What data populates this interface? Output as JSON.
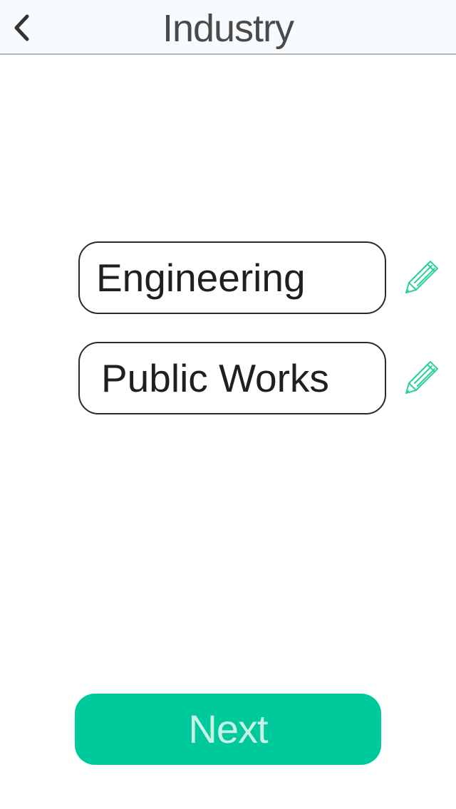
{
  "header": {
    "title": "Industry",
    "back_icon": "chevron-left-icon"
  },
  "fields": [
    {
      "value": "Engineering",
      "edit_icon": "pencil-icon"
    },
    {
      "value": "Public Works",
      "edit_icon": "pencil-icon"
    }
  ],
  "footer": {
    "next_label": "Next"
  },
  "colors": {
    "accent": "#00c99b",
    "accent_text": "#c9f2e6",
    "pencil": "#2fcf9f",
    "navbar_bg": "#f7fbfd",
    "field_border": "#2a2a2a"
  }
}
